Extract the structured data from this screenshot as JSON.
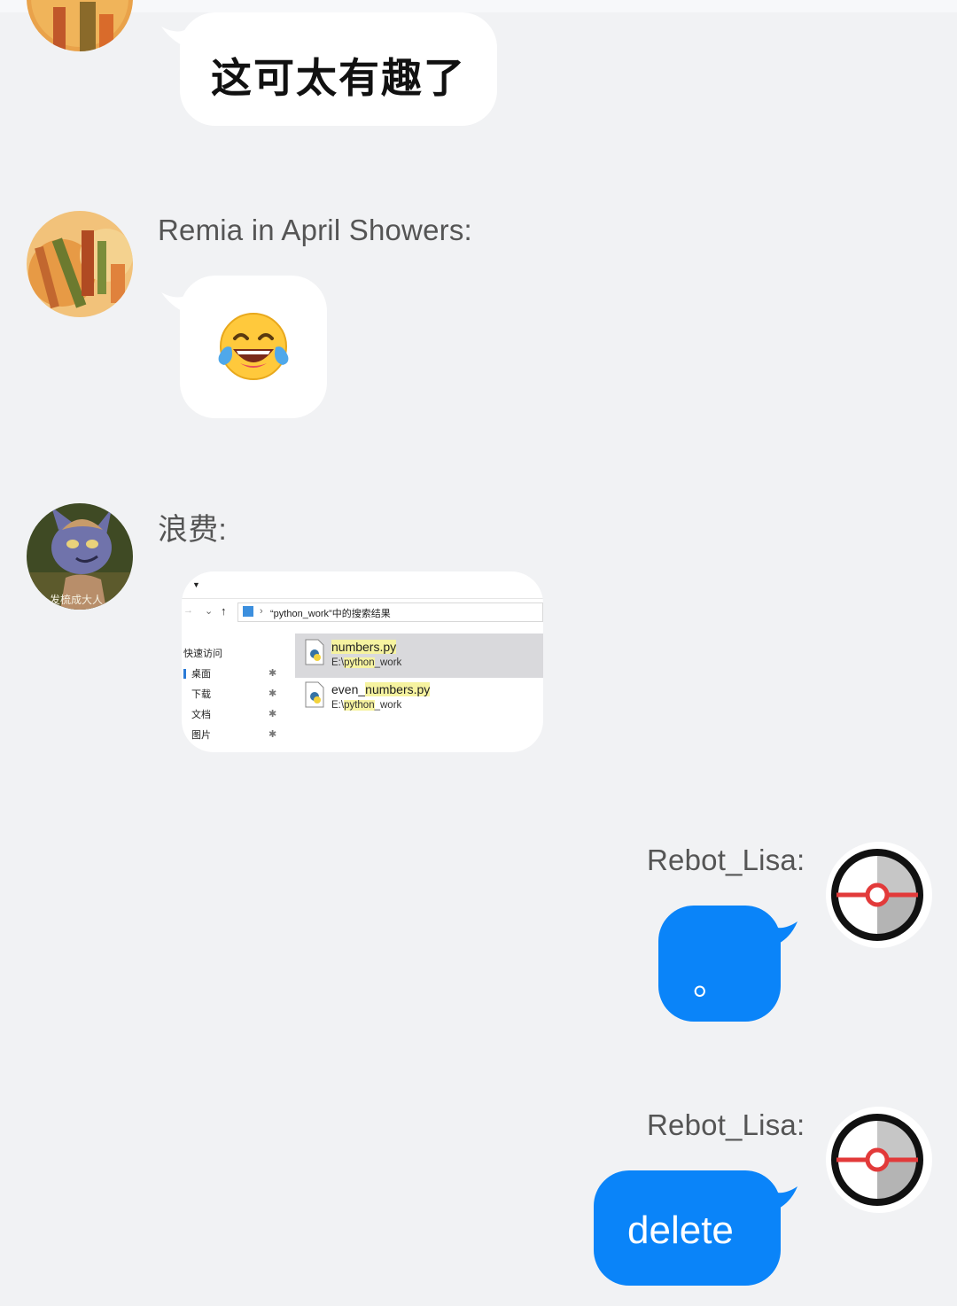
{
  "messages": [
    {
      "sender": "",
      "type": "text",
      "text": "这可太有趣了"
    },
    {
      "sender": "Remia in April Showers:",
      "type": "emoji",
      "text": "😂"
    },
    {
      "sender": "浪费:",
      "type": "image",
      "avatar_caption": "发梳成大人",
      "screenshot": {
        "search_title": "“python_work”中的搜索结果",
        "nav": [
          "快速访问",
          "桌面",
          "下载",
          "文档",
          "图片"
        ],
        "files": [
          {
            "name_pre": "",
            "name_hl": "numbers.py",
            "path_pre": "E:\\",
            "path_hl": "python",
            "path_post": "_work"
          },
          {
            "name_pre": "even_",
            "name_hl": "numbers.py",
            "path_pre": "E:\\",
            "path_hl": "python",
            "path_post": "_work"
          }
        ]
      }
    },
    {
      "sender": "Rebot_Lisa:",
      "type": "text",
      "text": "。"
    },
    {
      "sender": "Rebot_Lisa:",
      "type": "text",
      "text": "delete"
    }
  ],
  "colors": {
    "background": "#f1f2f4",
    "incoming_bubble": "#ffffff",
    "outgoing_bubble": "#0a84f9",
    "name_text": "#555555"
  }
}
